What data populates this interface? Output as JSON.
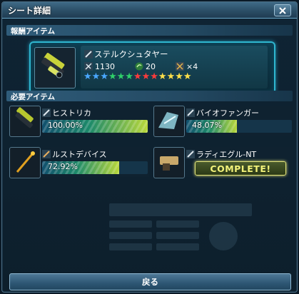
{
  "window": {
    "title": "シート詳細"
  },
  "reward_section": {
    "header": "報酬アイテム",
    "item": {
      "name": "ステルクシュタヤー",
      "icon": "weapon-icon",
      "power": "1130",
      "affix_count": "20",
      "slots": "×4",
      "rarity_stars": 13
    }
  },
  "required_section": {
    "header": "必要アイテム",
    "items": [
      {
        "name": "ヒストリカ",
        "icon": "weapon-icon",
        "progress_text": "100.00%",
        "progress": 1.0,
        "complete": false
      },
      {
        "name": "バイオファンガー",
        "icon": "weapon-icon",
        "progress_text": "48.07%",
        "progress": 0.4807,
        "complete": false
      },
      {
        "name": "ルストデバイス",
        "icon": "weapon-icon",
        "progress_text": "72.92%",
        "progress": 0.7292,
        "complete": false
      },
      {
        "name": "ラディエグル-NT",
        "icon": "weapon-icon",
        "progress_text": "",
        "progress": 1.0,
        "complete": true,
        "complete_label": "COMPLETE!"
      }
    ]
  },
  "footer": {
    "back_label": "戻る"
  },
  "colors": {
    "accent": "#2fb6cf",
    "complete": "#f2f27a"
  }
}
